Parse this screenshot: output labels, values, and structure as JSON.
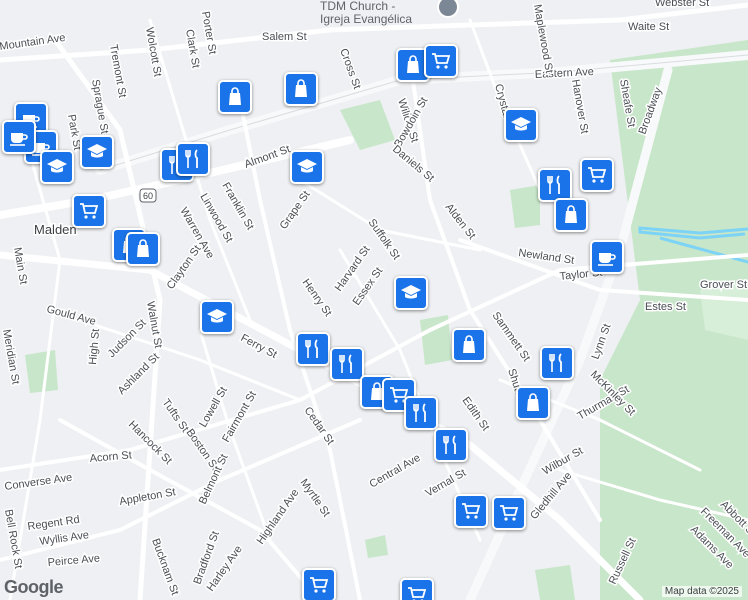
{
  "map": {
    "attribution": "Map data ©2025",
    "logo": "Google",
    "poi": {
      "line1": "TDM Church -",
      "line2": "Igreja Evangélica"
    },
    "colors": {
      "pin": "#1a73e8",
      "park": "#c8e6c9",
      "road": "#ffffff",
      "highway": "#f8f9fa"
    }
  },
  "streets": [
    {
      "name": "Salem St"
    },
    {
      "name": "Eastern Ave"
    },
    {
      "name": "Waite St"
    },
    {
      "name": "Webster St"
    },
    {
      "name": "Cross St"
    },
    {
      "name": "Willow St"
    },
    {
      "name": "Bowdoin St"
    },
    {
      "name": "Daniels St"
    },
    {
      "name": "Alden St"
    },
    {
      "name": "Newland St"
    },
    {
      "name": "Taylor St"
    },
    {
      "name": "Grover St"
    },
    {
      "name": "Estes St"
    },
    {
      "name": "Lynn St"
    },
    {
      "name": "Broadway"
    },
    {
      "name": "Ferry St"
    },
    {
      "name": "Main St"
    },
    {
      "name": "High St"
    },
    {
      "name": "Walnut St"
    },
    {
      "name": "Gould Ave"
    },
    {
      "name": "Judson St"
    },
    {
      "name": "Ashland St"
    },
    {
      "name": "Meridian St"
    },
    {
      "name": "Hancock St"
    },
    {
      "name": "Acorn St"
    },
    {
      "name": "Converse Ave"
    },
    {
      "name": "Appleton St"
    },
    {
      "name": "Regent Rd"
    },
    {
      "name": "Wyllis Ave"
    },
    {
      "name": "Peirce Ave"
    },
    {
      "name": "Bell Rock St"
    },
    {
      "name": "Tufts St"
    },
    {
      "name": "Boston St"
    },
    {
      "name": "Belmont St"
    },
    {
      "name": "Bucknam St"
    },
    {
      "name": "Harley Ave"
    },
    {
      "name": "Bradford St"
    },
    {
      "name": "Highland Ave"
    },
    {
      "name": "Myrtle St"
    },
    {
      "name": "Cedar St"
    },
    {
      "name": "Central Ave"
    },
    {
      "name": "Vernal St"
    },
    {
      "name": "Edith St"
    },
    {
      "name": "Sammett St"
    },
    {
      "name": "Shute St"
    },
    {
      "name": "Thurman St"
    },
    {
      "name": "McKinley St"
    },
    {
      "name": "Wilbur St"
    },
    {
      "name": "Gledhill Ave"
    },
    {
      "name": "Russell St"
    },
    {
      "name": "Adams Ave"
    },
    {
      "name": "Freeman Ave"
    },
    {
      "name": "Abbott St"
    },
    {
      "name": "Henry St"
    },
    {
      "name": "Harvard St"
    },
    {
      "name": "Essex St"
    },
    {
      "name": "Suffolk St"
    },
    {
      "name": "Grape St"
    },
    {
      "name": "Almont St"
    },
    {
      "name": "Franklin St"
    },
    {
      "name": "Linwood St"
    },
    {
      "name": "Warren Ave"
    },
    {
      "name": "Clayton St"
    },
    {
      "name": "Fairmont St"
    },
    {
      "name": "Lowell St"
    },
    {
      "name": "Tremont St"
    },
    {
      "name": "Sprague St"
    },
    {
      "name": "Wolcott St"
    },
    {
      "name": "Clark St"
    },
    {
      "name": "Porter St"
    },
    {
      "name": "Park St"
    },
    {
      "name": "Crystal St"
    },
    {
      "name": "Hanover St"
    },
    {
      "name": "Sheafe St"
    },
    {
      "name": "Maplewood St"
    },
    {
      "name": "Malden"
    },
    {
      "name": "Mountain Ave"
    }
  ],
  "pins": [
    {
      "type": "shopping-bag"
    },
    {
      "type": "shopping-bag"
    },
    {
      "type": "shopping-bag"
    },
    {
      "type": "cart"
    },
    {
      "type": "school"
    },
    {
      "type": "restaurant"
    },
    {
      "type": "cafe"
    },
    {
      "type": "cafe"
    },
    {
      "type": "cafe"
    },
    {
      "type": "school"
    },
    {
      "type": "school"
    },
    {
      "type": "cart"
    },
    {
      "type": "restaurant"
    },
    {
      "type": "shopping-bag"
    },
    {
      "type": "shopping-bag"
    },
    {
      "type": "school"
    },
    {
      "type": "restaurant"
    },
    {
      "type": "restaurant"
    },
    {
      "type": "shopping-bag"
    },
    {
      "type": "cart"
    },
    {
      "type": "restaurant"
    },
    {
      "type": "restaurant"
    },
    {
      "type": "school"
    },
    {
      "type": "shopping-bag"
    },
    {
      "type": "cart"
    },
    {
      "type": "restaurant"
    },
    {
      "type": "shopping-bag"
    },
    {
      "type": "restaurant"
    },
    {
      "type": "shopping-bag"
    },
    {
      "type": "cafe"
    },
    {
      "type": "cart"
    },
    {
      "type": "cart"
    },
    {
      "type": "school"
    },
    {
      "type": "cart"
    },
    {
      "type": "cart"
    }
  ],
  "highway_shield": "60"
}
